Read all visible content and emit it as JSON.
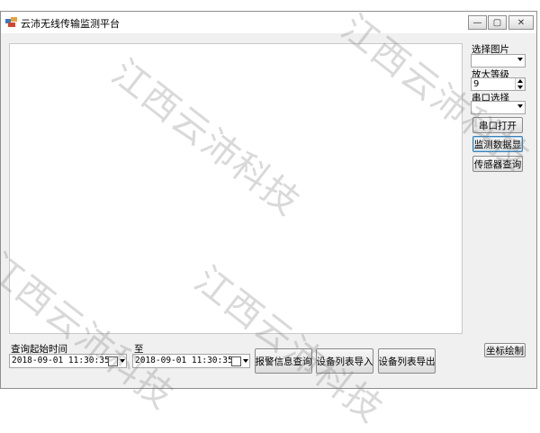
{
  "window": {
    "title": "云沛无线传输监测平台",
    "controls": {
      "minimize": "—",
      "maximize": "▢",
      "close": "✕"
    }
  },
  "side_panel": {
    "select_image_label": "选择图片",
    "select_image_value": "",
    "zoom_label": "放大等级",
    "zoom_value": "9",
    "serial_label": "串口选择",
    "serial_value": "",
    "open_port_button": "串口打开",
    "monitor_data_button": "监测数据显",
    "sensor_query_button": "传感器查询",
    "coord_draw_button": "坐标绘制"
  },
  "query_bar": {
    "start_time_label": "查询起始时间",
    "start_time_value": "2018-09-01  11:30:35",
    "to_label": "至",
    "end_time_value": "2018-09-01  11:30:35",
    "alarm_query_button": "报警信息查询",
    "device_import_button": "设备列表导入",
    "device_export_button": "设备列表导出"
  },
  "watermark": {
    "text": "江西云沛科技"
  },
  "colors": {
    "window_bg": "#f0f0f0",
    "canvas_bg": "#ffffff",
    "focus_border": "#3c7fb1"
  }
}
